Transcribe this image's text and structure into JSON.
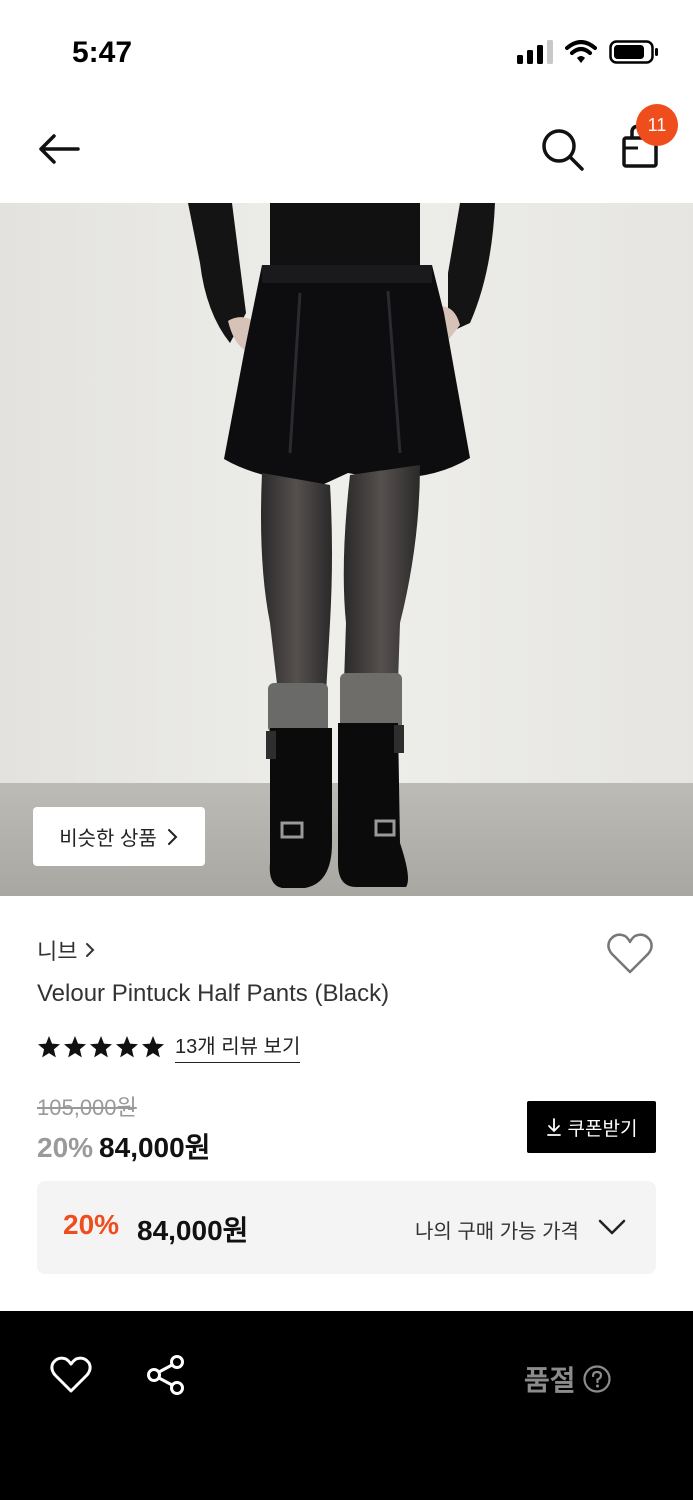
{
  "status": {
    "time": "5:47"
  },
  "cart": {
    "badge_count": "11"
  },
  "image": {
    "similar_button_label": "비슷한 상품"
  },
  "product": {
    "brand": "니브",
    "name": "Velour Pintuck Half Pants (Black)",
    "rating_stars": 5,
    "review_link": "13개 리뷰 보기",
    "original_price": "105,000원",
    "discount_rate": "20%",
    "sale_price": "84,000원"
  },
  "coupon": {
    "label": "쿠폰받기"
  },
  "my_price": {
    "discount_rate": "20%",
    "price": "84,000원",
    "label": "나의 구매 가능 가격"
  },
  "bottom_bar": {
    "status": "품절"
  },
  "colors": {
    "accent": "#f04d1d",
    "dark": "#000000"
  },
  "icons": [
    "back-arrow-icon",
    "search-icon",
    "shopping-bag-icon",
    "heart-icon",
    "star-icon",
    "download-icon",
    "chevron-down-icon",
    "share-icon",
    "question-icon"
  ]
}
